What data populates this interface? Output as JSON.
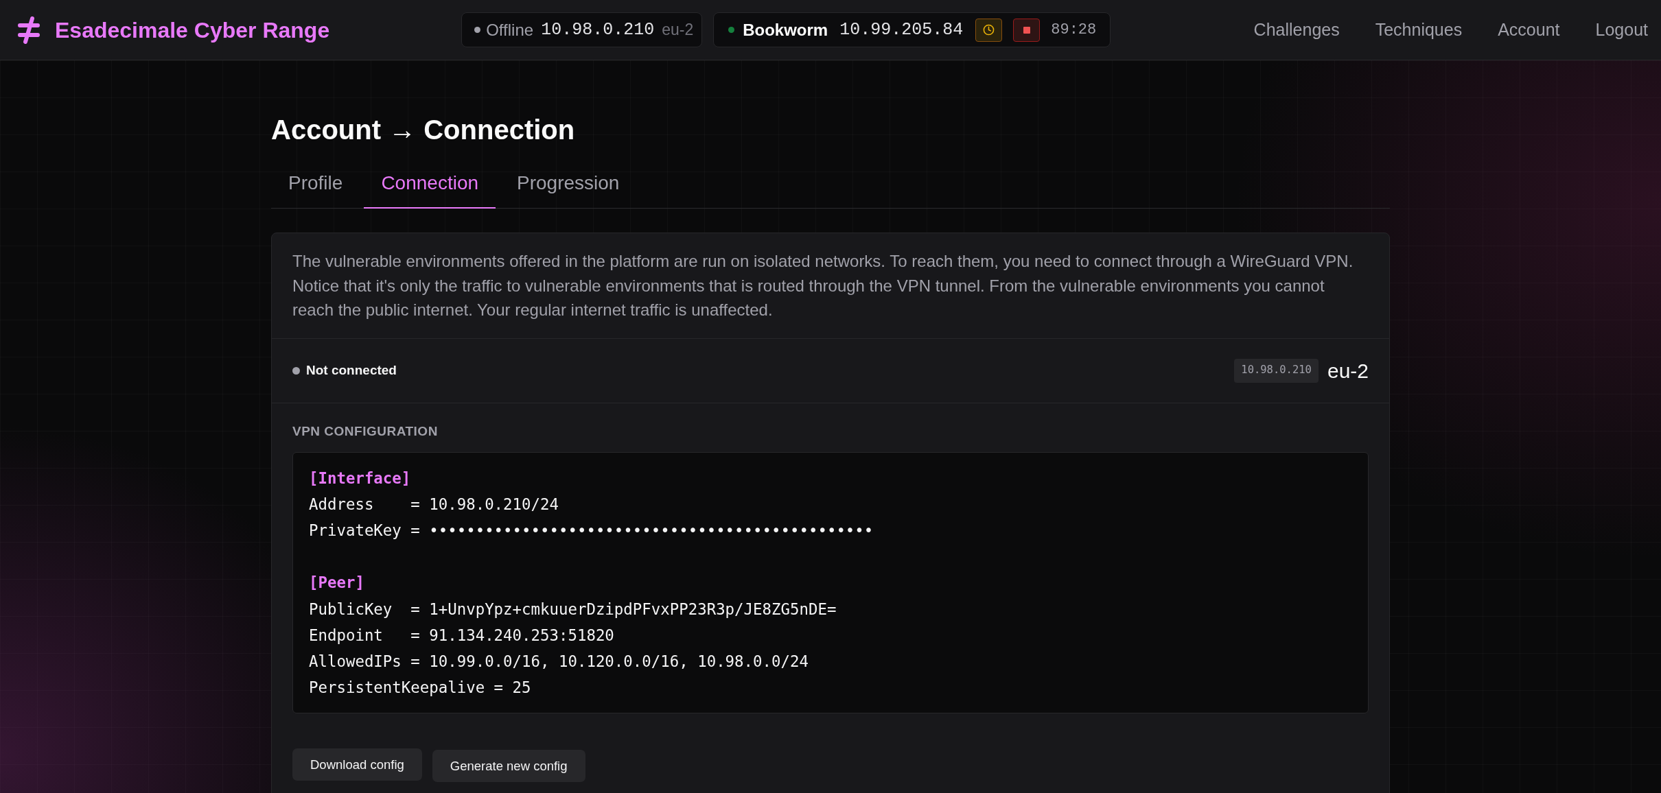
{
  "header": {
    "title": "Esadecimale Cyber Range",
    "connection": {
      "status": "Offline",
      "online": false,
      "ip": "10.98.0.210",
      "region": "eu-2"
    },
    "machine": {
      "name": "Bookworm",
      "running": true,
      "ip": "10.99.205.84",
      "timer": "89:28"
    },
    "nav": [
      "Challenges",
      "Techniques",
      "Account",
      "Logout"
    ]
  },
  "page": {
    "title": "Account → Connection"
  },
  "tabs": [
    {
      "label": "Profile",
      "selected": false
    },
    {
      "label": "Connection",
      "selected": true
    },
    {
      "label": "Progression",
      "selected": false
    }
  ],
  "intro": "The vulnerable environments offered in the platform are run on isolated networks. To reach them, you need to connect through a WireGuard VPN. Notice that it's only the traffic to vulnerable environments that is routed through the VPN tunnel. From the vulnerable environments you cannot reach the public internet. Your regular internet traffic is unaffected.",
  "status": {
    "label": "Not connected",
    "connected": false,
    "ip": "10.98.0.210",
    "region": "eu-2"
  },
  "vpn_configuration": {
    "heading": "VPN CONFIGURATION",
    "sections": [
      {
        "header": "[Interface]",
        "lines": [
          "Address    = 10.98.0.210/24",
          "PrivateKey = ••••••••••••••••••••••••••••••••••••••••••••••••"
        ]
      },
      {
        "header": "[Peer]",
        "lines": [
          "PublicKey  = 1+UnvpYpz+cmkuuerDzipdPFvxPP23R3p/JE8ZG5nDE=",
          "Endpoint   = 91.134.240.253:51820",
          "AllowedIPs = 10.99.0.0/16, 10.120.0.0/16, 10.98.0.0/24",
          "PersistentKeepalive = 25"
        ]
      }
    ]
  },
  "buttons": [
    "Download config",
    "Generate new config"
  ]
}
